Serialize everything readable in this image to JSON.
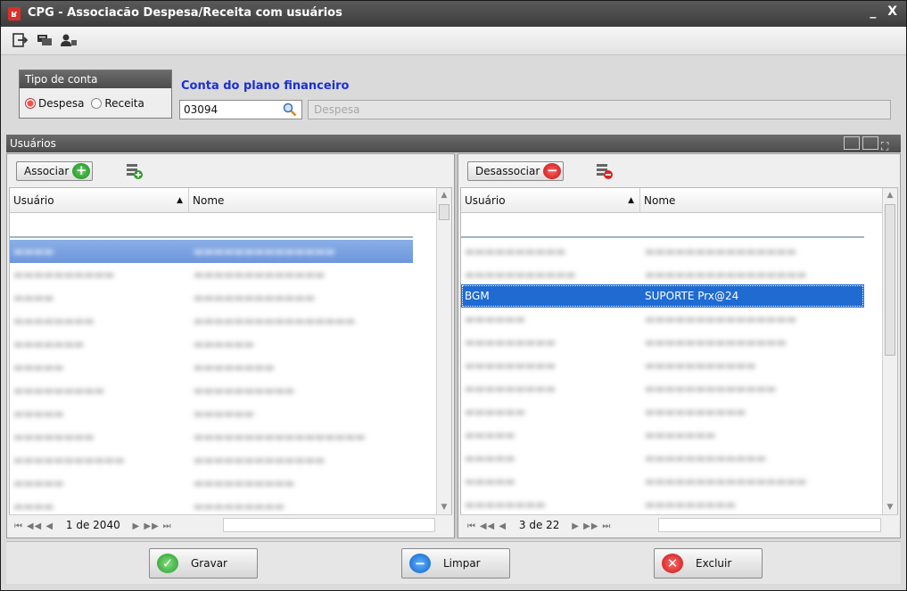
{
  "window": {
    "title": "CPG - Associacão Despesa/Receita com usuários",
    "minimize": "_",
    "close": "X"
  },
  "toolbar": {
    "icons": [
      "exit-icon",
      "chat-icon",
      "user-icon"
    ]
  },
  "tipo_conta": {
    "label": "Tipo de conta",
    "options": [
      "Despesa",
      "Receita"
    ],
    "selected": "Despesa"
  },
  "conta": {
    "label": "Conta do plano financeiro",
    "value": "03094",
    "description_placeholder": "Despesa"
  },
  "usuarios_section": {
    "label": "Usuários"
  },
  "left": {
    "action_label": "Associar",
    "columns": [
      "Usuário",
      "Nome"
    ],
    "pager": {
      "text": "1 de 2040"
    }
  },
  "right": {
    "action_label": "Desassociar",
    "columns": [
      "Usuário",
      "Nome"
    ],
    "selected_row": {
      "usuario": "BGM",
      "nome": "SUPORTE Prx@24"
    },
    "pager": {
      "text": "3 de 22"
    }
  },
  "buttons": {
    "gravar": "Gravar",
    "limpar": "Limpar",
    "excluir": "Excluir"
  },
  "colors": {
    "accent_blue": "#1a2fd6",
    "selection": "#1f6bd1",
    "header_dark": "#4c4c4c"
  }
}
